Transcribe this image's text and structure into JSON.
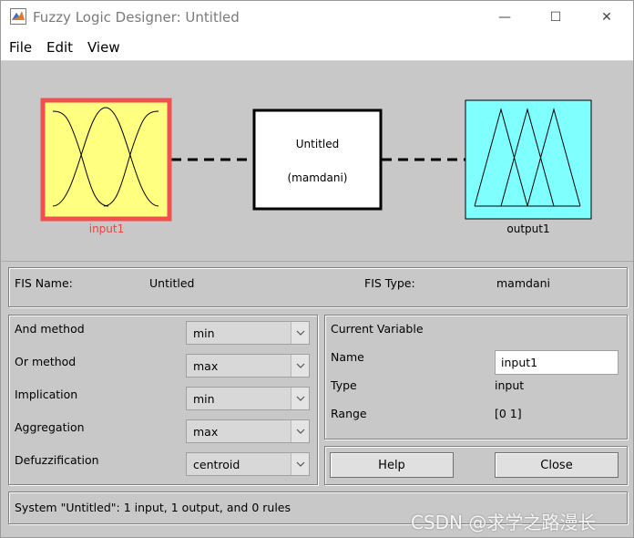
{
  "window": {
    "title": "Fuzzy Logic Designer: Untitled",
    "minimize_glyph": "—",
    "maximize_glyph": "☐",
    "close_glyph": "✕"
  },
  "menu": {
    "file": "File",
    "edit": "Edit",
    "view": "View"
  },
  "diagram": {
    "input_label": "input1",
    "output_label": "output1",
    "system_name": "Untitled",
    "system_type": "(mamdani)",
    "input_fill": "#ffff80",
    "input_border": "#f05050",
    "output_fill": "#80ffff"
  },
  "fis": {
    "name_label": "FIS Name:",
    "name_value": "Untitled",
    "type_label": "FIS Type:",
    "type_value": "mamdani"
  },
  "methods": {
    "and_label": "And method",
    "and_value": "min",
    "or_label": "Or method",
    "or_value": "max",
    "implication_label": "Implication",
    "implication_value": "min",
    "aggregation_label": "Aggregation",
    "aggregation_value": "max",
    "defuzz_label": "Defuzzification",
    "defuzz_value": "centroid"
  },
  "current_variable": {
    "title": "Current Variable",
    "name_label": "Name",
    "name_value": "input1",
    "type_label": "Type",
    "type_value": "input",
    "range_label": "Range",
    "range_value": "[0 1]"
  },
  "buttons": {
    "help": "Help",
    "close": "Close"
  },
  "status": {
    "text": "System \"Untitled\": 1 input, 1 output, and 0 rules"
  },
  "watermark": "CSDN @求学之路漫长"
}
